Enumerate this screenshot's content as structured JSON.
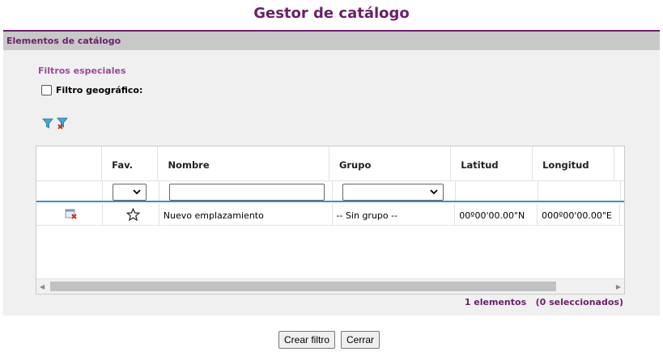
{
  "page": {
    "title": "Gestor de catálogo"
  },
  "panel": {
    "header": "Elementos de catálogo"
  },
  "filters": {
    "section_label": "Filtros especiales",
    "geo_filter_label": "Filtro geográfico:",
    "geo_filter_checked": false
  },
  "table": {
    "columns": [
      "",
      "Fav.",
      "Nombre",
      "Grupo",
      "Latitud",
      "Longitud"
    ],
    "rows": [
      {
        "action_icon": "delete-icon",
        "favorite_icon": "star-outline-icon",
        "nombre": "Nuevo emplazamiento",
        "grupo": "-- Sin grupo --",
        "latitud": "00º00'00.00\"N",
        "longitud": "000º00'00.00\"E"
      }
    ]
  },
  "status": {
    "count": "1 elementos   (0 seleccionados)"
  },
  "buttons": {
    "create_filter": "Crear filtro",
    "close": "Cerrar"
  },
  "colors": {
    "accent": "#6b1f6b",
    "filter_label": "#9b4a9b",
    "grid_separator": "#3d8ec9"
  }
}
